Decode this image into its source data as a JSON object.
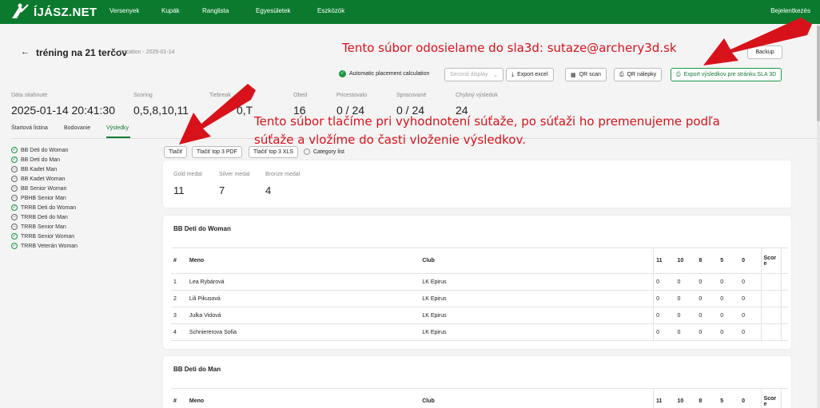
{
  "nav": {
    "logo_text": "ÍJÁSZ.NET",
    "items": [
      "Versenyek",
      "Kupák",
      "Ranglista",
      "Egyesületek",
      "Eszközök"
    ],
    "login": "Bejelentkezés"
  },
  "header": {
    "back_icon": "arrow-left-icon",
    "title": "tréning na 21 terčov",
    "subtitle": "Location - 2025-01-14",
    "backup": "Backup"
  },
  "toolbar": {
    "auto_placement": "Automatic placement calculation",
    "second_display": "Second display",
    "export_excel": "Export excel",
    "qr_scan": "QR scan",
    "qr_stickers": "QR nálepky",
    "export_sla": "Export výsledkov pre stránku SLA 3D"
  },
  "stats": [
    {
      "label": "Dáta stiahnuté",
      "value": "2025-01-14 20:41:30"
    },
    {
      "label": "Scoring",
      "value": "0,5,8,10,11"
    },
    {
      "label": "Tiebreak",
      "value": "0,T"
    },
    {
      "label": "Obed",
      "value": "16"
    },
    {
      "label": "Pricestovalo",
      "value": "0 / 24"
    },
    {
      "label": "Spracované",
      "value": "0 / 24"
    },
    {
      "label": "Chybný výsledok",
      "value": "24"
    }
  ],
  "tabs": [
    "Štartová listina",
    "Bodovanie",
    "Výsledky"
  ],
  "active_tab": "Výsledky",
  "categories": [
    {
      "name": "BB Deti do Woman",
      "done": true
    },
    {
      "name": "BB Deti do Man",
      "done": true
    },
    {
      "name": "BB Kadet Man",
      "done": false
    },
    {
      "name": "BB Kadet Woman",
      "done": false
    },
    {
      "name": "BB Senior Woman",
      "done": false
    },
    {
      "name": "PBHB Senior Man",
      "done": false
    },
    {
      "name": "TRRB Deti do Woman",
      "done": true
    },
    {
      "name": "TRRB Deti do Man",
      "done": false
    },
    {
      "name": "TRRB Senior Man",
      "done": false
    },
    {
      "name": "TRRB Senior Woman",
      "done": true
    },
    {
      "name": "TRRB Veterán Woman",
      "done": true
    }
  ],
  "print": {
    "print": "Tlačiť",
    "top3pdf": "Tlačiť top 3 PDF",
    "top3xls": "Tlačiť top 3 XLS",
    "category_list": "Category list"
  },
  "medals": [
    {
      "label": "Gold medal",
      "value": "11"
    },
    {
      "label": "Silver medal",
      "value": "7"
    },
    {
      "label": "Bronze medal",
      "value": "4"
    }
  ],
  "table_headers": {
    "num": "#",
    "name": "Meno",
    "club": "Club",
    "c11": "11",
    "c10": "10",
    "c8": "8",
    "c5": "5",
    "c0": "0",
    "score": "Score"
  },
  "results": [
    {
      "title": "BB Deti do Woman",
      "rows": [
        {
          "num": "1",
          "name": "Lea Rybárová",
          "club": "LK Epirus",
          "c11": "0",
          "c10": "0",
          "c8": "0",
          "c5": "0",
          "c0": "0",
          "score": ""
        },
        {
          "num": "2",
          "name": "Lili Pikusová",
          "club": "LK Epirus",
          "c11": "0",
          "c10": "0",
          "c8": "0",
          "c5": "0",
          "c0": "0",
          "score": ""
        },
        {
          "num": "3",
          "name": "Julka Vidová",
          "club": "LK Epirus",
          "c11": "0",
          "c10": "0",
          "c8": "0",
          "c5": "0",
          "c0": "0",
          "score": ""
        },
        {
          "num": "4",
          "name": "Schniererova Sofia",
          "club": "LK Epirus",
          "c11": "0",
          "c10": "0",
          "c8": "0",
          "c5": "0",
          "c0": "0",
          "score": ""
        }
      ]
    },
    {
      "title": "BB Deti do Man",
      "rows": []
    }
  ],
  "annotations": {
    "top": "Tento súbor odosielame do sla3d: sutaze@archery3d.sk",
    "middle_line1": "Tento súbor tlačíme pri vyhodnotení súťaže, po súťaži ho premenujeme podľa",
    "middle_line2": "súťaže a vložíme do časti vloženie výsledkov."
  },
  "colors": {
    "brand_green": "#0b7a2e",
    "accent_green": "#117a33",
    "annotation_red": "#d8121b"
  }
}
